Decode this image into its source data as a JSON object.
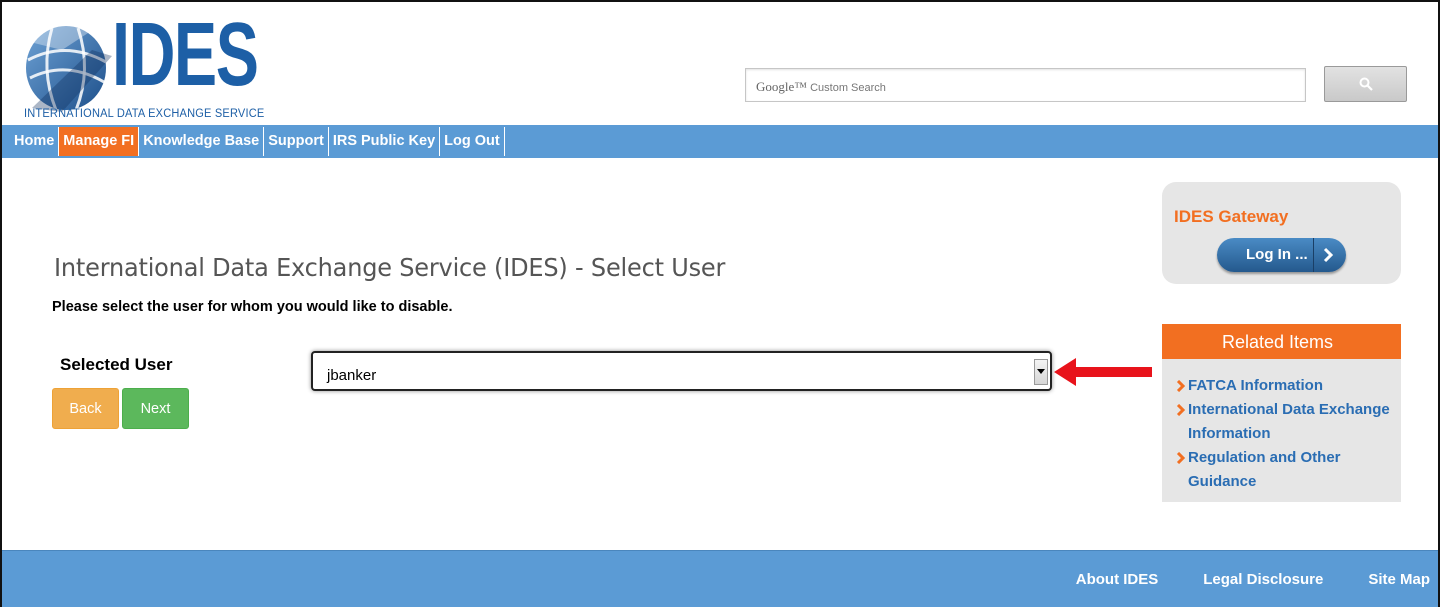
{
  "header": {
    "logo_word": "IDES",
    "logo_subtitle": "INTERNATIONAL DATA EXCHANGE SERVICE",
    "search": {
      "brand": "Google™",
      "placeholder": "Custom Search"
    }
  },
  "nav": {
    "items": [
      {
        "label": "Home",
        "active": false
      },
      {
        "label": "Manage FI",
        "active": true
      },
      {
        "label": "Knowledge Base",
        "active": false
      },
      {
        "label": "Support",
        "active": false
      },
      {
        "label": "IRS Public Key",
        "active": false
      },
      {
        "label": "Log Out",
        "active": false
      }
    ]
  },
  "main": {
    "title": "International Data Exchange Service (IDES) - Select User",
    "instruction": "Please select the user for whom you would like to disable.",
    "field_label": "Selected User",
    "selected_user": "jbanker",
    "back_label": "Back",
    "next_label": "Next"
  },
  "sidebar": {
    "gateway_title": "IDES Gateway",
    "login_label": "Log In ...",
    "related_title": "Related Items",
    "related_items": [
      "FATCA Information",
      "International Data Exchange Information",
      "Regulation and Other Guidance"
    ]
  },
  "footer": {
    "links": [
      "About IDES",
      "Legal Disclosure",
      "Site Map"
    ]
  },
  "colors": {
    "brand_blue": "#5b9bd5",
    "accent_orange": "#f26f21",
    "link_blue": "#2a6db3",
    "back_button": "#f0ad4e",
    "next_button": "#5cb85c",
    "annotation_arrow": "#e8131b"
  }
}
